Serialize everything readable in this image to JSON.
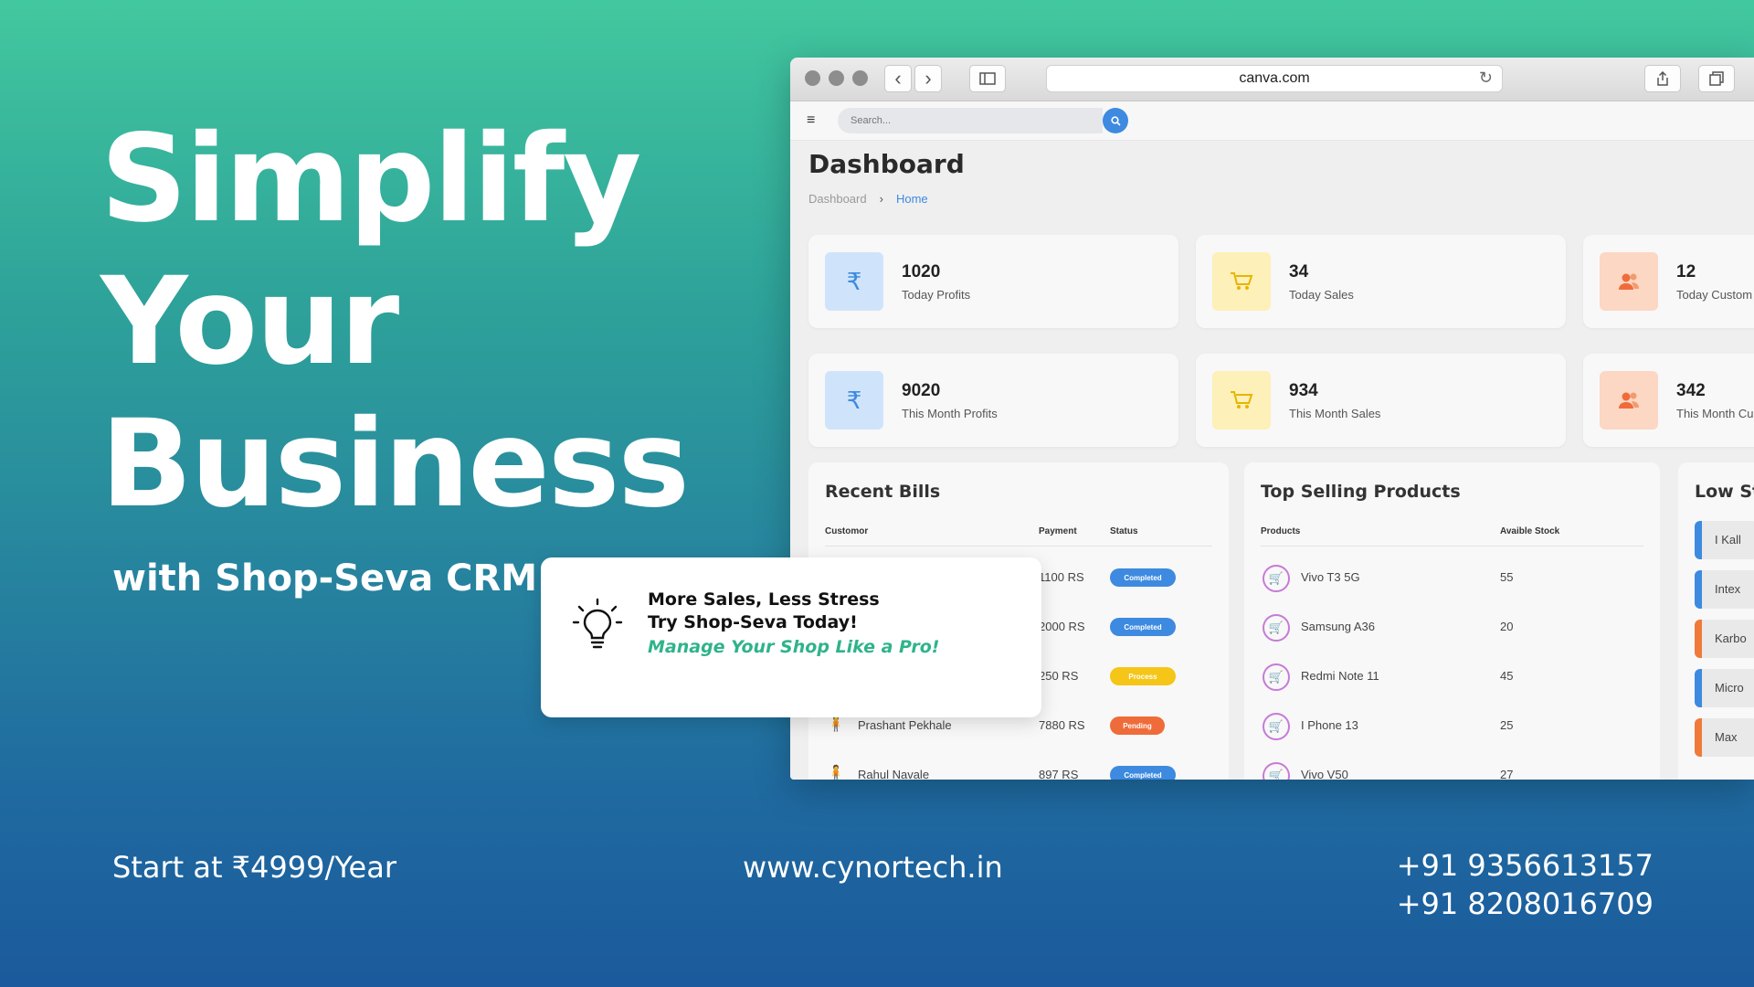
{
  "hero": {
    "line1": "Simplify",
    "line2": "Your",
    "line3": "Business",
    "tagline": "with Shop-Seva CRM"
  },
  "footer": {
    "price": "Start at ₹4999/Year",
    "website": "www.cynortech.in",
    "phone1": "+91 9356613157",
    "phone2": "+91 8208016709"
  },
  "browser": {
    "url": "canva.com"
  },
  "app": {
    "search_placeholder": "Search...",
    "page_title": "Dashboard",
    "breadcrumb": {
      "parent": "Dashboard",
      "current": "Home"
    },
    "stats": [
      {
        "value": "1020",
        "label": "Today Profits",
        "icon": "rupee-icon"
      },
      {
        "value": "34",
        "label": "Today Sales",
        "icon": "cart-icon"
      },
      {
        "value": "12",
        "label": "Today Custom",
        "icon": "users-icon"
      },
      {
        "value": "9020",
        "label": "This Month Profits",
        "icon": "rupee-icon"
      },
      {
        "value": "934",
        "label": "This Month Sales",
        "icon": "cart-icon"
      },
      {
        "value": "342",
        "label": "This Month Cu",
        "icon": "users-icon"
      }
    ],
    "recent_bills": {
      "title": "Recent Bills",
      "headers": {
        "customer": "Customor",
        "payment": "Payment",
        "status": "Status"
      },
      "rows": [
        {
          "customer": "",
          "payment": "1100 RS",
          "status": "Completed",
          "color": "#3d8ae0"
        },
        {
          "customer": "",
          "payment": "2000 RS",
          "status": "Completed",
          "color": "#3d8ae0"
        },
        {
          "customer": "",
          "payment": "250 RS",
          "status": "Process",
          "color": "#f5c518"
        },
        {
          "customer": "Prashant Pekhale",
          "payment": "7880 RS",
          "status": "Pending",
          "color": "#ef6c3a"
        },
        {
          "customer": "Rahul Navale",
          "payment": "897 RS",
          "status": "Completed",
          "color": "#3d8ae0"
        }
      ]
    },
    "top_products": {
      "title": "Top Selling Products",
      "headers": {
        "product": "Products",
        "stock": "Avaible Stock"
      },
      "rows": [
        {
          "name": "Vivo T3 5G",
          "stock": "55"
        },
        {
          "name": "Samsung A36",
          "stock": "20"
        },
        {
          "name": "Redmi Note 11",
          "stock": "45"
        },
        {
          "name": "I Phone 13",
          "stock": "25"
        },
        {
          "name": "Vivo V50",
          "stock": "27"
        }
      ]
    },
    "low_stock": {
      "title": "Low St",
      "items": [
        {
          "name": "I Kall",
          "color": "blue"
        },
        {
          "name": "Intex",
          "color": "blue"
        },
        {
          "name": "Karbo",
          "color": "orange"
        },
        {
          "name": "Micro",
          "color": "blue"
        },
        {
          "name": "Max",
          "color": "orange"
        }
      ]
    }
  },
  "callout": {
    "line1": "More Sales, Less Stress",
    "line2": "Try Shop-Seva Today!",
    "line3": "Manage Your Shop Like a Pro!"
  },
  "colors": {
    "accent_blue": "#3d8ae0",
    "accent_green": "#2fb38a",
    "rupee_bg": "#cfe4fb",
    "cart_bg": "#fdf0b8",
    "users_bg": "#fcd7c3"
  }
}
